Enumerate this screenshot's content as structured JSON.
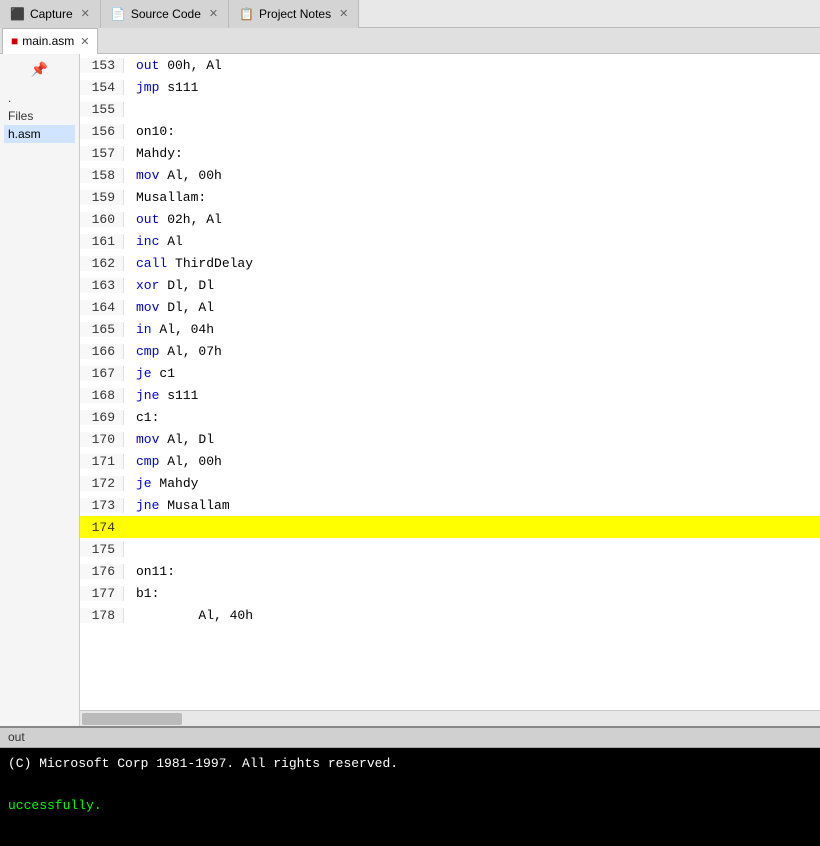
{
  "tabs": [
    {
      "label": "Capture",
      "active": false,
      "closable": true,
      "icon": "capture"
    },
    {
      "label": "Source Code",
      "active": false,
      "closable": true,
      "icon": "code"
    },
    {
      "label": "Project Notes",
      "active": true,
      "closable": true,
      "icon": "notes"
    }
  ],
  "active_tab": "main.asm",
  "file_tab": {
    "label": "main.asm",
    "active": true
  },
  "sidebar": {
    "items": [
      {
        "label": ".)",
        "active": false
      },
      {
        "label": "Files",
        "active": false
      },
      {
        "label": "h.asm",
        "active": true
      }
    ]
  },
  "code_lines": [
    {
      "number": 153,
      "content": "        out 00h, Al",
      "highlighted": false
    },
    {
      "number": 154,
      "content": "        jmp s111",
      "highlighted": false
    },
    {
      "number": 155,
      "content": "",
      "highlighted": false
    },
    {
      "number": 156,
      "content": "on10:",
      "highlighted": false
    },
    {
      "number": 157,
      "content": "Mahdy:",
      "highlighted": false
    },
    {
      "number": 158,
      "content": "        mov Al, 00h",
      "highlighted": false
    },
    {
      "number": 159,
      "content": "Musallam:",
      "highlighted": false
    },
    {
      "number": 160,
      "content": "        out 02h, Al",
      "highlighted": false
    },
    {
      "number": 161,
      "content": "        inc Al",
      "highlighted": false
    },
    {
      "number": 162,
      "content": "        call ThirdDelay",
      "highlighted": false
    },
    {
      "number": 163,
      "content": "        xor Dl, Dl",
      "highlighted": false
    },
    {
      "number": 164,
      "content": "        mov Dl, Al",
      "highlighted": false
    },
    {
      "number": 165,
      "content": "        in Al, 04h",
      "highlighted": false
    },
    {
      "number": 166,
      "content": "        cmp Al, 07h",
      "highlighted": false
    },
    {
      "number": 167,
      "content": "        je c1",
      "highlighted": false
    },
    {
      "number": 168,
      "content": "        jne s111",
      "highlighted": false
    },
    {
      "number": 169,
      "content": "c1:",
      "highlighted": false
    },
    {
      "number": 170,
      "content": "        mov Al, Dl",
      "highlighted": false
    },
    {
      "number": 171,
      "content": "        cmp Al, 00h",
      "highlighted": false
    },
    {
      "number": 172,
      "content": "        je Mahdy",
      "highlighted": false
    },
    {
      "number": 173,
      "content": "        jne Musallam",
      "highlighted": false
    },
    {
      "number": 174,
      "content": "",
      "highlighted": true
    },
    {
      "number": 175,
      "content": "",
      "highlighted": false
    },
    {
      "number": 176,
      "content": "on11:",
      "highlighted": false
    },
    {
      "number": 177,
      "content": "b1:",
      "highlighted": false
    },
    {
      "number": 178,
      "content": "        Al, 40h",
      "highlighted": false
    }
  ],
  "output": {
    "label": "out",
    "lines": [
      {
        "text": "(C) Microsoft Corp 1981-1997.  All rights reserved.",
        "color": "white"
      },
      {
        "text": "",
        "color": "white"
      },
      {
        "text": "uccessfully.",
        "color": "green"
      }
    ]
  },
  "colors": {
    "keyword": "#0000cc",
    "highlight": "#ffff00",
    "background": "#ffffff",
    "output_bg": "#000000"
  }
}
